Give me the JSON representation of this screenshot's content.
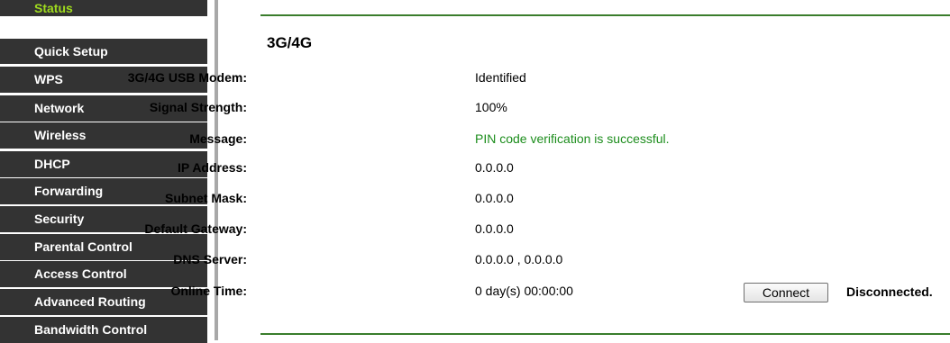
{
  "sidebar": {
    "items": [
      {
        "label": "Status",
        "active": true
      },
      {
        "label": "Quick Setup"
      },
      {
        "label": "WPS"
      },
      {
        "label": "Network"
      },
      {
        "label": "Wireless"
      },
      {
        "label": "DHCP"
      },
      {
        "label": "Forwarding"
      },
      {
        "label": "Security"
      },
      {
        "label": "Parental Control"
      },
      {
        "label": "Access Control"
      },
      {
        "label": "Advanced Routing"
      },
      {
        "label": "Bandwidth Control"
      }
    ]
  },
  "main": {
    "title": "3G/4G",
    "rows": [
      {
        "label": "3G/4G USB Modem:",
        "value": "Identified"
      },
      {
        "label": "Signal Strength:",
        "value": "100%"
      },
      {
        "label": "Message:",
        "value": "PIN code verification is successful."
      },
      {
        "label": "IP Address:",
        "value": "0.0.0.0"
      },
      {
        "label": "Subnet Mask:",
        "value": "0.0.0.0"
      },
      {
        "label": "Default Gateway:",
        "value": "0.0.0.0"
      },
      {
        "label": "DNS Server:",
        "value": "0.0.0.0 , 0.0.0.0"
      },
      {
        "label": "Online Time:",
        "value": "0 day(s) 00:00:00"
      }
    ],
    "connect_label": "Connect",
    "status": "Disconnected."
  },
  "colors": {
    "sidebar_bg": "#333333",
    "active_text": "#9fdb1e",
    "message_green": "#1c8d1c",
    "rule_green": "#3a7d2c"
  }
}
